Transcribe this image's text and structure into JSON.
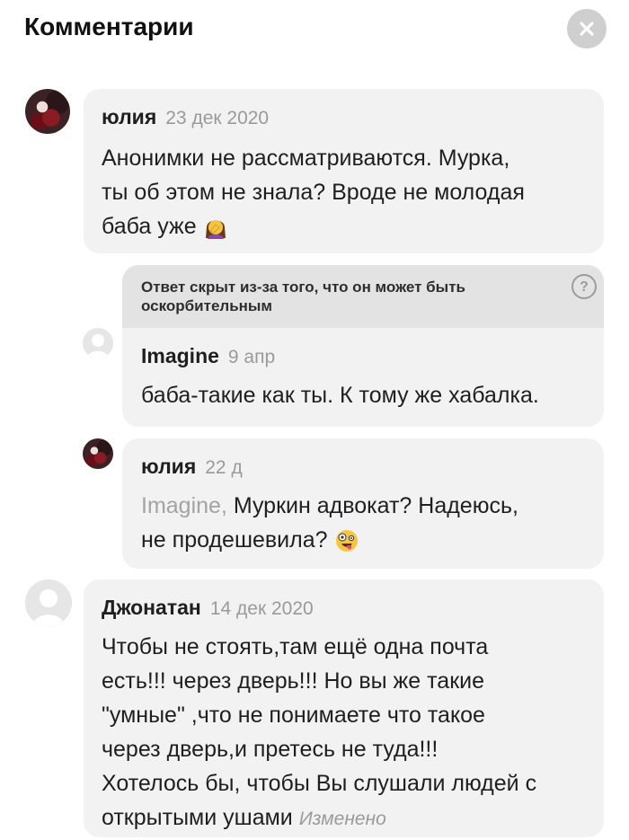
{
  "header": {
    "title": "Комментарии",
    "close_icon": "close-icon"
  },
  "comments": [
    {
      "author": "юлия",
      "date": "23 дек 2020",
      "text_lines": [
        "Анонимки не рассматриваются. Мурка,",
        "ты об этом не знала? Вроде не молодая",
        "баба уже"
      ],
      "emoji": "face-palm-woman-emoji"
    },
    {
      "hidden_notice": [
        "Ответ скрыт из-за того, что он может быть",
        "оскорбительным"
      ],
      "help_symbol": "?",
      "author": "Imagine",
      "date": "9 апр",
      "text_lines": [
        "баба-такие как ты. К тому же хабалка."
      ]
    },
    {
      "author": "юлия",
      "date": "22 д",
      "mention": "Imagine,",
      "text_lines": [
        "Муркин адвокат? Надеюсь,",
        "не продешевила?"
      ],
      "emoji": "zany-face-emoji"
    },
    {
      "author": "Джонатан",
      "date": "14 дек 2020",
      "text_lines": [
        "Чтобы не стоять,там ещё одна почта",
        "есть!!! через дверь!!! Но вы же такие",
        "\"умные\" ,что не понимаете что такое",
        "через дверь,и претесь не туда!!!",
        "Хотелось бы, чтобы Вы слушали людей с",
        "открытыми ушами"
      ],
      "edited_label": "Изменено"
    }
  ]
}
